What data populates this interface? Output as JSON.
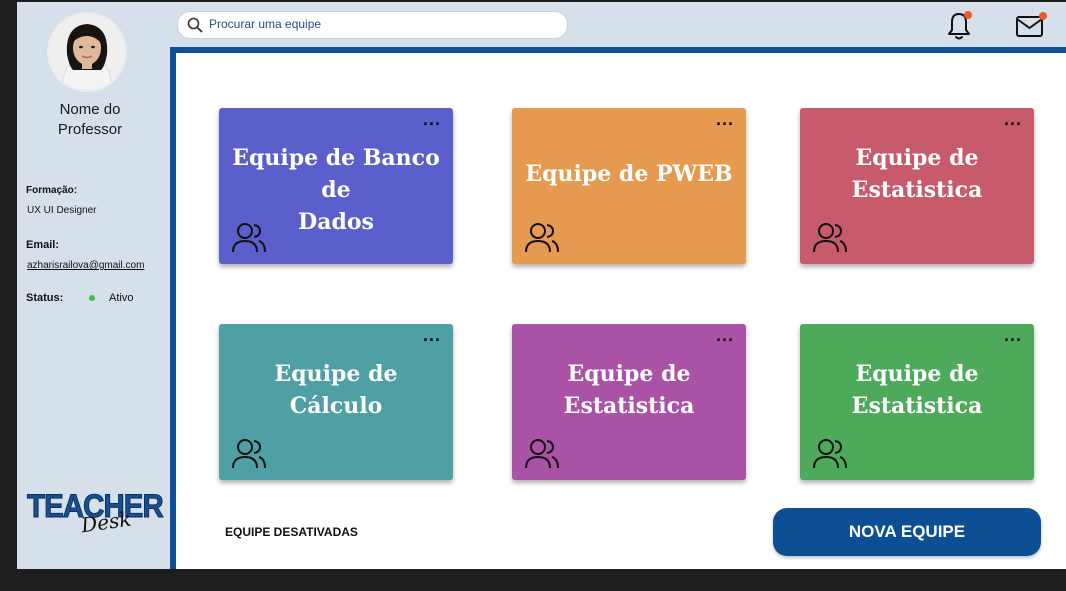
{
  "sidebar": {
    "professor_name_line1": "Nome do",
    "professor_name_line2": "Professor",
    "formacao_label": "Formação:",
    "formacao_value": "UX UI Designer",
    "email_label": "Email:",
    "email_value": "azharisrailova@gmail.com",
    "status_label": "Status:",
    "status_value": "Ativo",
    "status_color": "#3fbf55",
    "logo_main": "TEACHER",
    "logo_sub": "Desk"
  },
  "header": {
    "search_placeholder": "Procurar uma equipe",
    "notification_dot_color": "#f05a28"
  },
  "cards": [
    {
      "line1": "Equipe de Banco de",
      "line2": "Dados",
      "color": "#5b5fcb"
    },
    {
      "line1": "Equipe de PWEB",
      "line2": "",
      "color": "#e59a50"
    },
    {
      "line1": "Equipe de",
      "line2": "Estatistica",
      "color": "#c75a6b"
    },
    {
      "line1": "Equipe de",
      "line2": "Cálculo",
      "color": "#4fa0a4"
    },
    {
      "line1": "Equipe de",
      "line2": "Estatistica",
      "color": "#aa52a6"
    },
    {
      "line1": "Equipe de",
      "line2": "Estatistica",
      "color": "#4daa5b"
    }
  ],
  "card_menu": "...",
  "footer": {
    "deactivated_label": "EQUIPE DESATIVADAS",
    "new_team_button": "NOVA EQUIPE"
  }
}
